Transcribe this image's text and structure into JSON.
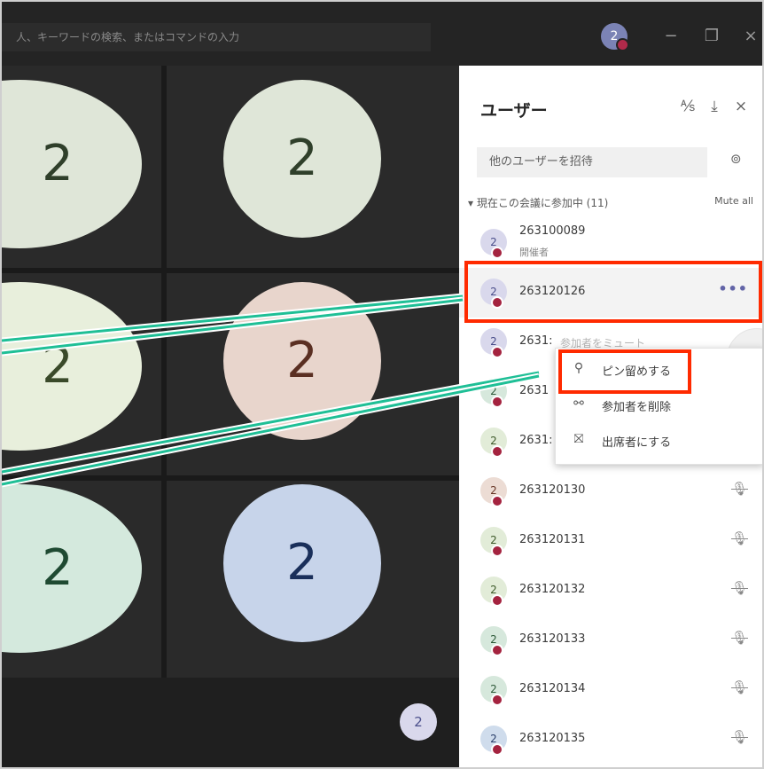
{
  "search": {
    "text": "人、キーワードの検索、またはコマンドの入力"
  },
  "titlebar": {
    "avatar_text": "2",
    "minimize": "−",
    "restore": "❐",
    "close": "×"
  },
  "grid": {
    "tiles": [
      {
        "text": "2",
        "color": "#dfe6d8",
        "text_color": "#2f3f2a"
      },
      {
        "text": "2",
        "color": "#dfe6d8",
        "text_color": "#2f3f2a"
      },
      {
        "text": "2",
        "color": "#e8efdc",
        "text_color": "#3a4a2a"
      },
      {
        "text": "2",
        "color": "#e8d5cc",
        "text_color": "#5a2f22"
      },
      {
        "text": "2",
        "color": "#d4e9dd",
        "text_color": "#1f4a32"
      },
      {
        "text": "2",
        "color": "#c7d4ea",
        "text_color": "#1a2f5a"
      }
    ],
    "bottom_avatar": "2"
  },
  "panel": {
    "title": "ユーザー",
    "icons": {
      "mute": "⅍",
      "download": "⤓",
      "close": "×"
    },
    "invite_placeholder": "他のユーザーを招待",
    "share_icon": "⊚",
    "section_label": "▾ 現在この会議に参加中 (11)",
    "mute_all": "Mute all",
    "participants": [
      {
        "avatar": "2",
        "name": "263100089",
        "sub": "開催者",
        "color": "#d9d8ec",
        "text_color": "#4b4f8b"
      },
      {
        "avatar": "2",
        "name": "263120126",
        "more": "•••",
        "color": "#d9d8ec",
        "text_color": "#4b4f8b"
      },
      {
        "avatar": "2",
        "name": "2631:",
        "greyed": "参加者をミュート",
        "color": "#d9d8ec",
        "text_color": "#4b4f8b"
      },
      {
        "avatar": "2",
        "name": "2631",
        "color": "#d6e8dc",
        "text_color": "#2e5a3a"
      },
      {
        "avatar": "2",
        "name": "2631:",
        "color": "#e2ecd8",
        "text_color": "#3e5a2a"
      },
      {
        "avatar": "2",
        "name": "263120130",
        "mic": "🎙",
        "color": "#ecdcd4",
        "text_color": "#6a3a2a"
      },
      {
        "avatar": "2",
        "name": "263120131",
        "mic": "🎙",
        "color": "#e2ecd8",
        "text_color": "#3e5a2a"
      },
      {
        "avatar": "2",
        "name": "263120132",
        "mic": "🎙",
        "color": "#e2ecd8",
        "text_color": "#3e5a2a"
      },
      {
        "avatar": "2",
        "name": "263120133",
        "mic": "🎙",
        "color": "#d6e8dc",
        "text_color": "#2e5a3a"
      },
      {
        "avatar": "2",
        "name": "263120134",
        "mic": "🎙",
        "color": "#d6e8dc",
        "text_color": "#2e5a3a"
      },
      {
        "avatar": "2",
        "name": "263120135",
        "mic": "🎙",
        "color": "#cfdcec",
        "text_color": "#2a3e6a"
      }
    ]
  },
  "context_menu": {
    "items": [
      {
        "icon": "⚲",
        "label": "ピン留めする"
      },
      {
        "icon": "⚯",
        "label": "参加者を削除"
      },
      {
        "icon": "⛝",
        "label": "出席者にする"
      }
    ]
  },
  "colors": {
    "highlight": "#ff2a00",
    "pointer_line": "#1fbf96"
  }
}
